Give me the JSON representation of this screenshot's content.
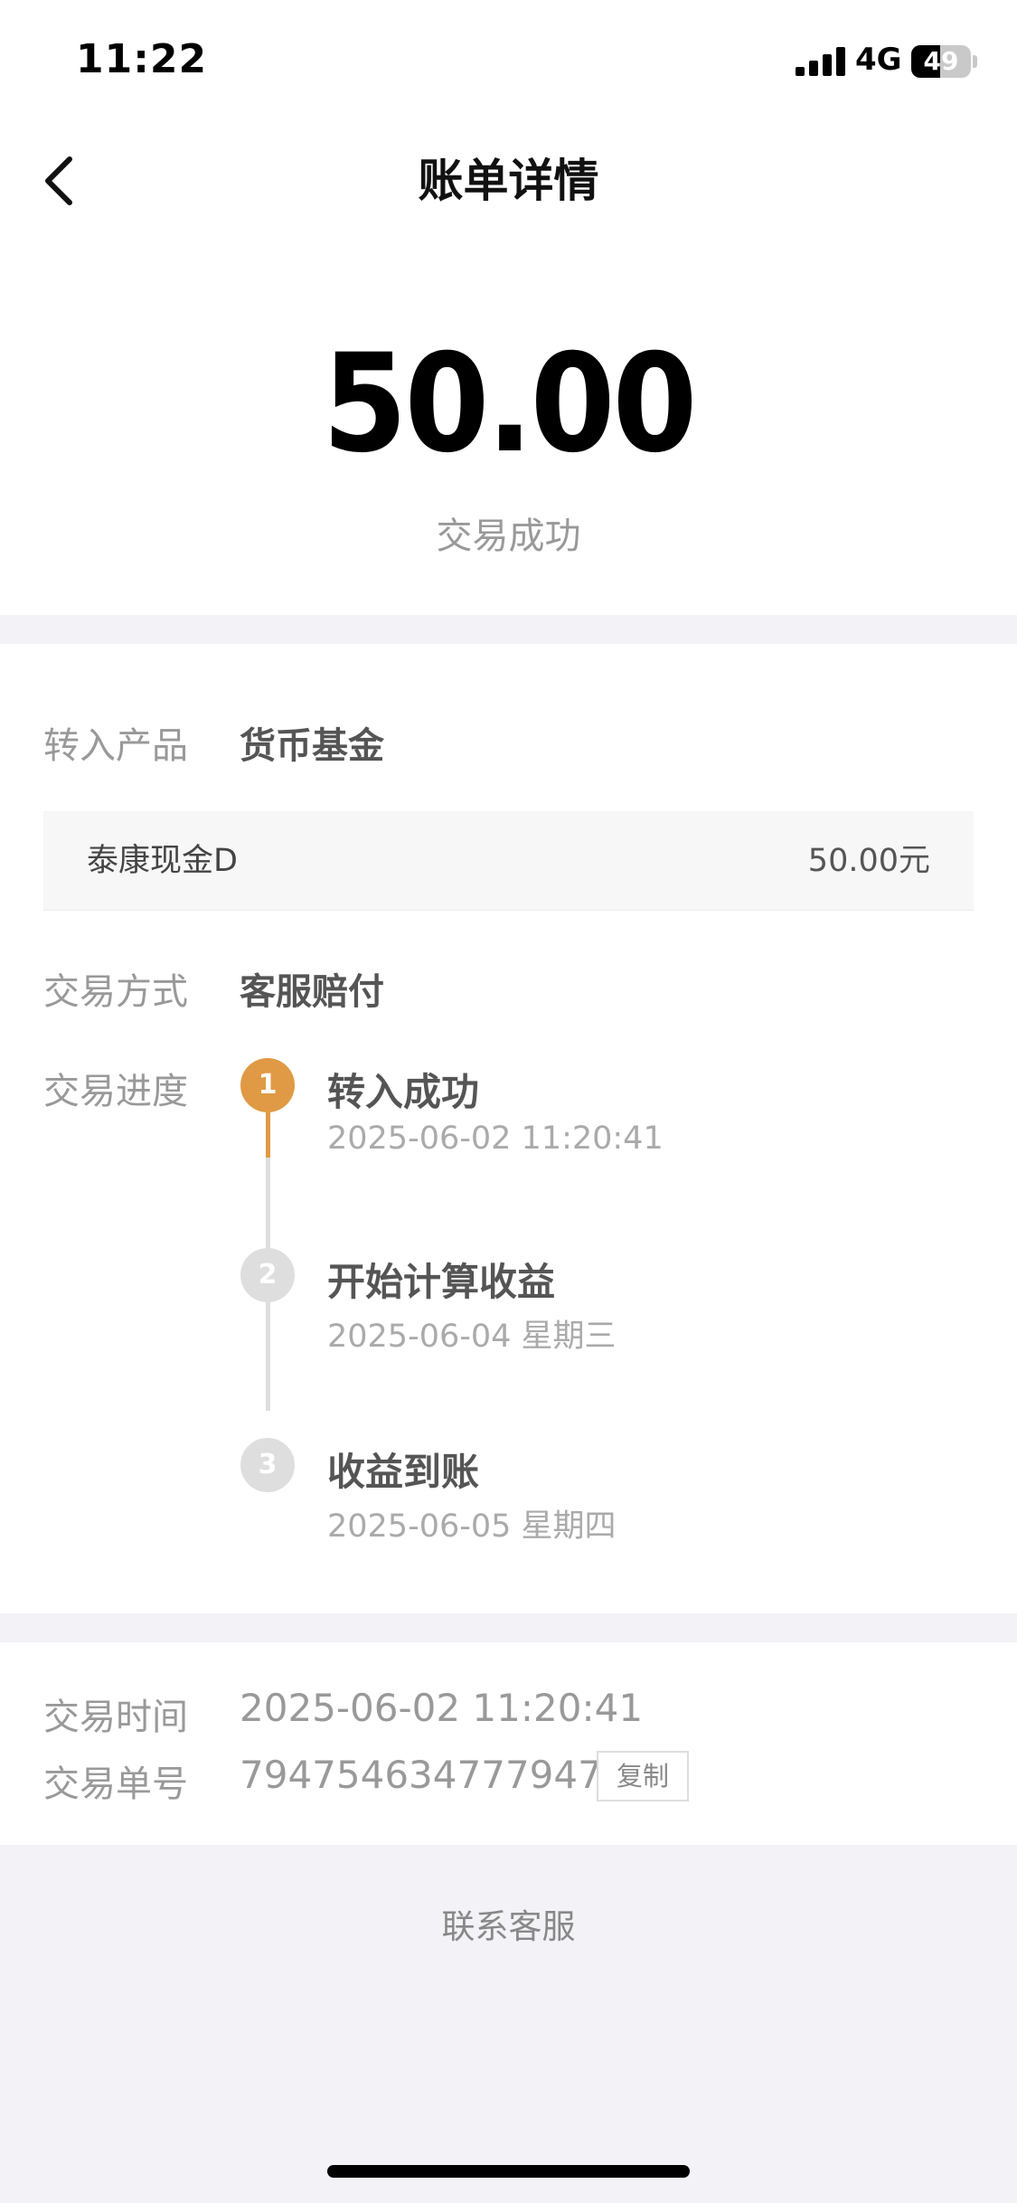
{
  "status_bar": {
    "time": "11:22",
    "network": "4G",
    "battery_level": "49",
    "battery_fraction": 0.49
  },
  "nav": {
    "title": "账单详情",
    "back_icon": "chevron-left-icon"
  },
  "summary": {
    "amount": "50.00",
    "status": "交易成功"
  },
  "details": {
    "product_label": "转入产品",
    "product_value": "货币基金",
    "fund_name": "泰康现金D",
    "fund_amount": "50.00元",
    "method_label": "交易方式",
    "method_value": "客服赔付",
    "progress_label": "交易进度",
    "steps": [
      {
        "number": "1",
        "title": "转入成功",
        "date": "2025-06-02 11:20:41",
        "done": true
      },
      {
        "number": "2",
        "title": "开始计算收益",
        "date": "2025-06-04 星期三",
        "done": false
      },
      {
        "number": "3",
        "title": "收益到账",
        "date": "2025-06-05 星期四",
        "done": false
      }
    ]
  },
  "meta": {
    "time_label": "交易时间",
    "time_value": "2025-06-02 11:20:41",
    "order_label": "交易单号",
    "order_value": "794754634777947",
    "copy_label": "复制"
  },
  "footer": {
    "contact_label": "联系客服"
  },
  "colors": {
    "accent": "#e09a45",
    "inactive": "#dedede",
    "background": "#f2f2f7"
  }
}
